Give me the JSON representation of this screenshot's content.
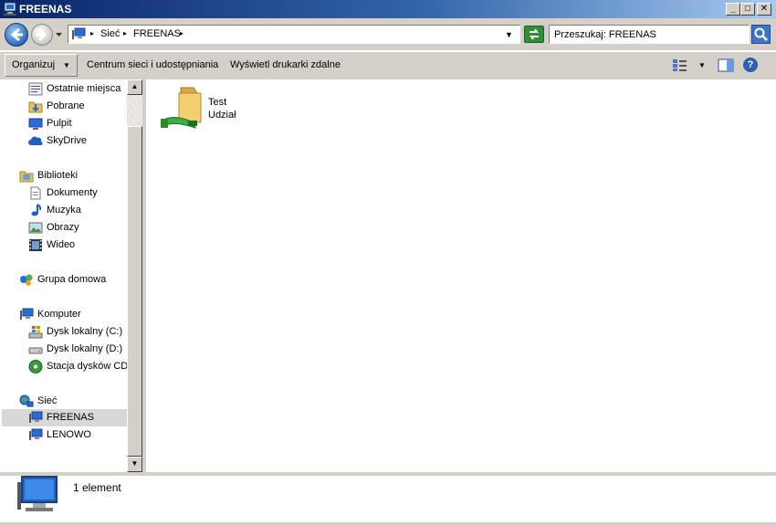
{
  "window": {
    "title": "FREENAS"
  },
  "address": {
    "crumbs": [
      "Sieć",
      "FREENAS"
    ],
    "search_placeholder": "Przeszukaj: FREENAS"
  },
  "toolbar": {
    "organize": "Organizuj",
    "network_center": "Centrum sieci i udostępniania",
    "remote_printers": "Wyświetl drukarki zdalne"
  },
  "nav": {
    "recent": "Ostatnie miejsca",
    "downloads": "Pobrane",
    "desktop": "Pulpit",
    "skydrive": "SkyDrive",
    "libraries": "Biblioteki",
    "documents": "Dokumenty",
    "music": "Muzyka",
    "pictures": "Obrazy",
    "video": "Wideo",
    "homegroup": "Grupa domowa",
    "computer": "Komputer",
    "drive_c": "Dysk lokalny (C:)",
    "drive_d": "Dysk lokalny (D:)",
    "cd_drive": "Stacja dysków CD",
    "network": "Sieć",
    "freenas": "FREENAS",
    "lenowo": "LENOWO"
  },
  "content": {
    "items": [
      {
        "name": "Test",
        "type": "Udział"
      }
    ]
  },
  "details": {
    "count": "1 element"
  }
}
